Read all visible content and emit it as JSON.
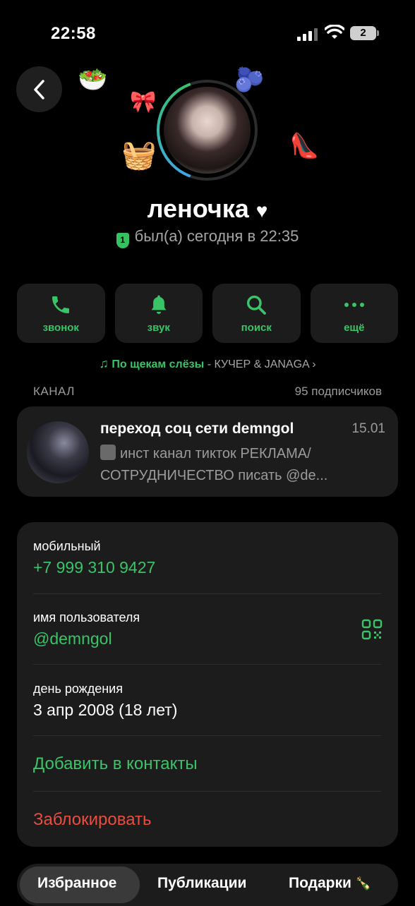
{
  "status_bar": {
    "time": "22:58",
    "battery": "2"
  },
  "profile": {
    "name": "леночка",
    "verification_badge": "1",
    "status": "был(а) сегодня в 22:35"
  },
  "actions": [
    {
      "label": "звонок",
      "icon": "phone-icon"
    },
    {
      "label": "звук",
      "icon": "bell-icon"
    },
    {
      "label": "поиск",
      "icon": "search-icon"
    },
    {
      "label": "ещё",
      "icon": "more-icon"
    }
  ],
  "song": {
    "title": "По щекам слёзы",
    "artist": "- КУЧЕР & JANAGA"
  },
  "channel": {
    "section_label": "КАНАЛ",
    "subscribers": "95 подписчиков",
    "title": "переход соц сети demngol",
    "date": "15.01",
    "preview_line1": "инст канал тикток РЕКЛАМА/",
    "preview_line2": "СОТРУДНИЧЕСТВО писать @de..."
  },
  "info": {
    "mobile_label": "мобильный",
    "mobile_value": "+7 999 310 9427",
    "username_label": "имя пользователя",
    "username_value": "@demngol",
    "birthday_label": "день рождения",
    "birthday_value": "3 апр 2008 (18 лет)",
    "add_contact": "Добавить в контакты",
    "block": "Заблокировать"
  },
  "tabs": [
    {
      "label": "Избранное",
      "active": true
    },
    {
      "label": "Публикации",
      "active": false
    },
    {
      "label": "Подарки",
      "active": false
    }
  ],
  "colors": {
    "accent": "#39c468",
    "danger": "#ea4d3d",
    "card": "#1c1c1c"
  }
}
